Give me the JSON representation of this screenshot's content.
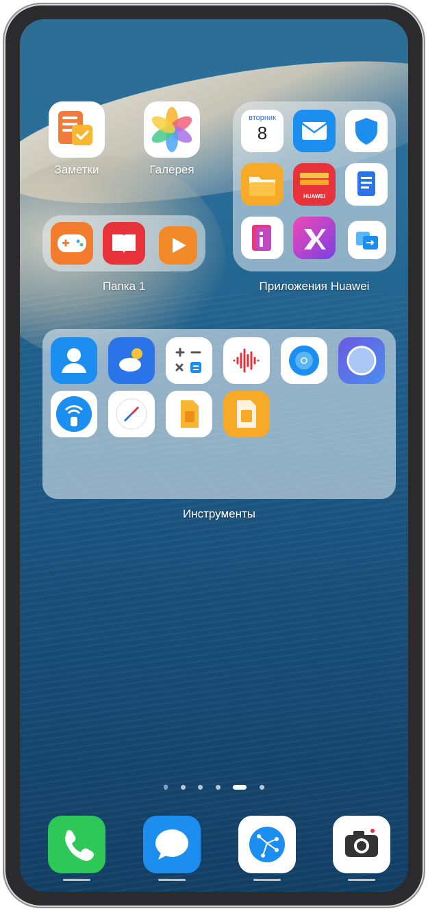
{
  "home_screen": {
    "apps": [
      {
        "label": "Заметки",
        "icon": "notes-icon"
      },
      {
        "label": "Галерея",
        "icon": "gallery-icon"
      }
    ],
    "folders": [
      {
        "label": "Папка 1",
        "icons": [
          "game-icon",
          "books-icon",
          "video-icon"
        ]
      },
      {
        "label": "Приложения Huawei",
        "icons": [
          "calendar-icon",
          "email-icon",
          "security-icon",
          "files-icon",
          "wallet-icon",
          "docs-icon",
          "tips-icon",
          "themes-icon",
          "phone-clone-icon"
        ]
      },
      {
        "label": "Инструменты",
        "icons": [
          "contacts-icon",
          "weather-icon",
          "calculator-icon",
          "recorder-icon",
          "mirror-icon",
          "magnifier-icon",
          "remote-icon",
          "compass-icon",
          "sim-icon",
          "sim-toolkit-icon"
        ]
      }
    ],
    "calendar": {
      "weekday": "вторник",
      "day": "8"
    },
    "wallet_brand": "HUAWEI"
  },
  "page_indicator": {
    "pages": 6,
    "active": 4
  },
  "dock": {
    "icons": [
      "phone-icon",
      "messages-icon",
      "browser-icon",
      "camera-icon"
    ]
  },
  "colors": {
    "accent": "#1e88e5",
    "wallpaper_sea": "#1f5f8c"
  }
}
